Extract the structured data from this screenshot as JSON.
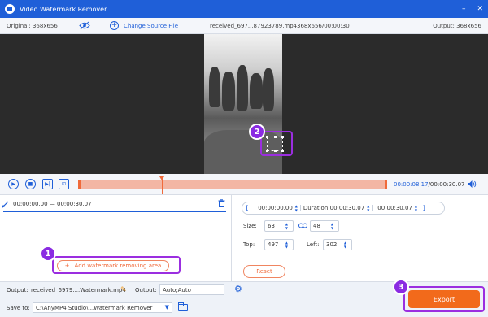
{
  "window": {
    "title": "Video Watermark Remover",
    "minimize": "–",
    "close": "✕"
  },
  "infobar": {
    "original_res": "Original: 368x656",
    "add_source": "Change Source File",
    "file_name": "received_697...87923789.mp4",
    "file_meta": "368x656/00:00:30",
    "output_res": "Output: 368x656"
  },
  "callouts": {
    "one": "1",
    "two": "2",
    "three": "3"
  },
  "player": {
    "current_time": "00:00:08.17",
    "total_time": "/00:00:30.07",
    "progress": 0.27
  },
  "clip": {
    "range": "00:00:00.00 — 00:00:30.07"
  },
  "add_area_label": "Add watermark removing area",
  "time_range": {
    "start": "00:00:00.00",
    "duration_label": "Duration:",
    "duration": "00:00:30.07",
    "end": "00:00:30.07"
  },
  "area": {
    "size_label": "Size:",
    "width": "63",
    "height": "48",
    "top_label": "Top:",
    "top": "497",
    "left_label": "Left:",
    "left": "302"
  },
  "reset_label": "Reset",
  "bottom": {
    "output_label": "Output:",
    "output_name": "received_6979....Watermark.mp4",
    "output_format_label": "Output:",
    "output_format": "Auto;Auto",
    "save_label": "Save to:",
    "save_path": "C:\\AnyMP4 Studio\\...Watermark Remover"
  },
  "export_label": "Export",
  "colors": {
    "accent": "#1f5fd8",
    "orange": "#f26a1b",
    "callout": "#8a2be2"
  }
}
